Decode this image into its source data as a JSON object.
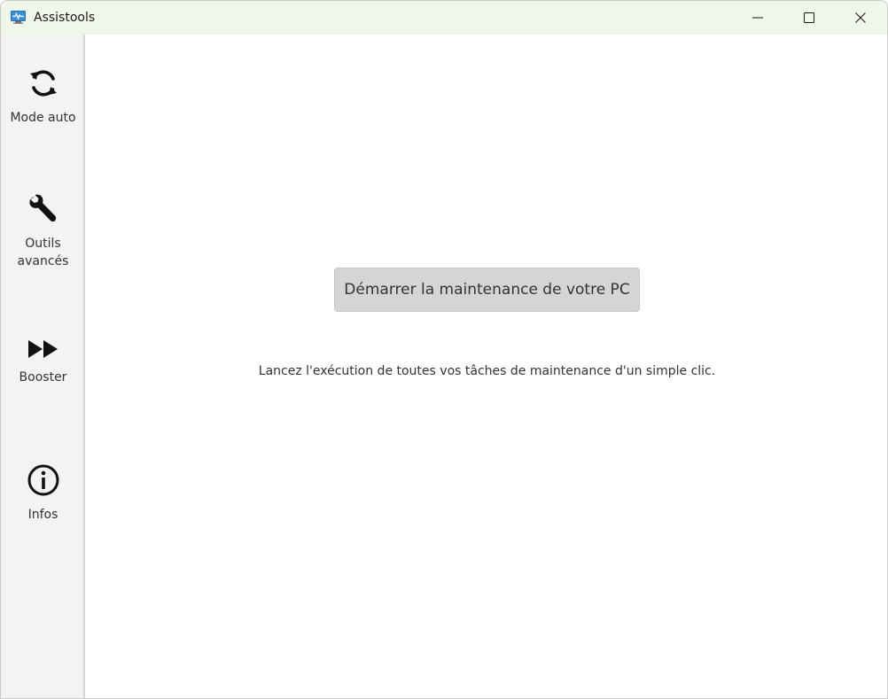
{
  "window": {
    "title": "Assistools",
    "icon": "monitor-pulse-icon"
  },
  "title_buttons": {
    "minimize": "minimize-icon",
    "maximize": "maximize-icon",
    "close": "close-icon"
  },
  "sidebar": {
    "items": [
      {
        "icon": "refresh-icon",
        "label": "Mode auto"
      },
      {
        "icon": "wrench-icon",
        "label": "Outils\navancés"
      },
      {
        "icon": "fast-forward-icon",
        "label": "Booster"
      },
      {
        "icon": "info-icon",
        "label": "Infos"
      }
    ]
  },
  "main": {
    "start_button_label": "Démarrer la maintenance de votre PC",
    "description": "Lancez l'exécution de toutes vos tâches de maintenance d'un simple clic."
  },
  "colors": {
    "titlebar_bg": "#f0f7e9",
    "sidebar_bg": "#f3f3f3",
    "button_bg": "#d5d5d5",
    "text": "#333333"
  }
}
